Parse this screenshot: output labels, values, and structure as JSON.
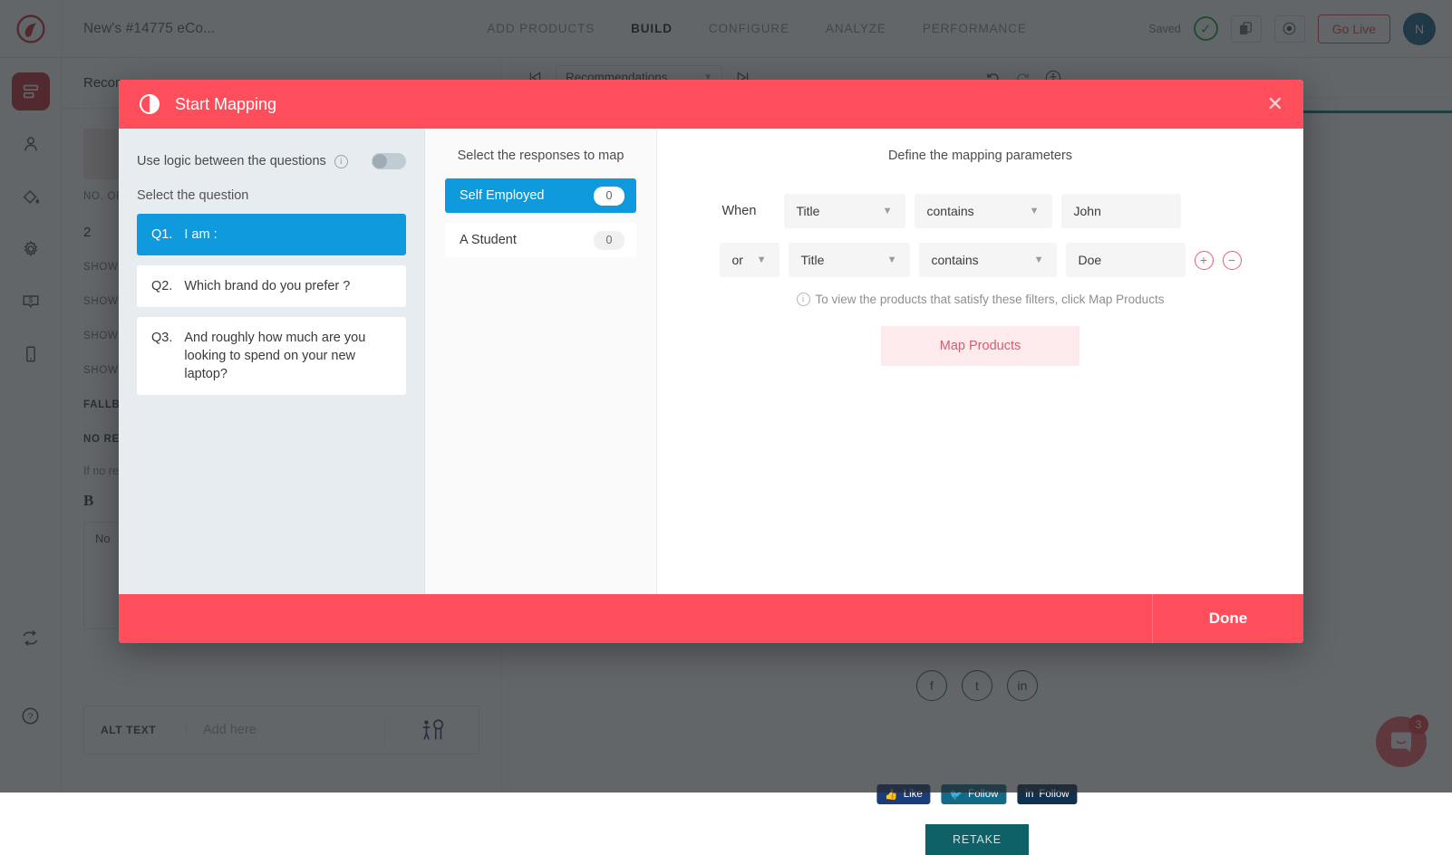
{
  "topbar": {
    "logo_icon": "brand-logo-icon",
    "project_title": "New's #14775 eCo...",
    "nav": [
      {
        "label": "ADD PRODUCTS",
        "active": false
      },
      {
        "label": "BUILD",
        "active": true
      },
      {
        "label": "CONFIGURE",
        "active": false
      },
      {
        "label": "ANALYZE",
        "active": false
      },
      {
        "label": "PERFORMANCE",
        "active": false
      }
    ],
    "saved_label": "Saved",
    "saved_check_icon": "check-circle-icon",
    "copy_icon": "duplicate-icon",
    "preview_icon": "eye-icon",
    "go_live_label": "Go Live",
    "avatar_initial": "N"
  },
  "rail": {
    "items": [
      {
        "icon": "content-list-icon",
        "active": true
      },
      {
        "icon": "person-icon",
        "active": false
      },
      {
        "icon": "paint-bucket-icon",
        "active": false
      },
      {
        "icon": "gear-icon",
        "active": false
      },
      {
        "icon": "price-bubble-icon",
        "active": false
      },
      {
        "icon": "mobile-device-icon",
        "active": false
      }
    ],
    "bottom": [
      {
        "icon": "sync-icon"
      },
      {
        "icon": "help-circle-icon"
      }
    ]
  },
  "config_panel": {
    "heading": "Recom",
    "no_of_label": "NO. OF",
    "no_of_value": "2",
    "show_rows": [
      "SHOW",
      "SHOW",
      "SHOW",
      "SHOW"
    ],
    "fallback_label": "FALLBA",
    "no_results_label": "NO RE",
    "if_no_text": "If no re",
    "bold_tool": "B",
    "editor_text": "No",
    "alt_text_label": "ALT TEXT",
    "alt_text_placeholder": "Add here",
    "alt_image_icon": "person-search-icon"
  },
  "preview_toolbar": {
    "prev_icon": "skip-previous-icon",
    "select_value": "Recommendations",
    "caret_icon": "chevron-down-icon",
    "next_icon": "skip-next-icon",
    "undo_icon": "undo-icon",
    "redo_icon": "redo-icon",
    "accessibility_icon": "accessibility-icon"
  },
  "preview": {
    "social_circles": [
      {
        "icon": "facebook-icon",
        "glyph": "f"
      },
      {
        "icon": "twitter-icon",
        "glyph": "t"
      },
      {
        "icon": "linkedin-icon",
        "glyph": "in"
      }
    ],
    "social_buttons": [
      {
        "icon": "thumbs-up-icon",
        "label": "Like"
      },
      {
        "icon": "twitter-bird-icon",
        "label": "Follow"
      },
      {
        "icon": "linkedin-in-icon",
        "label": "Follow"
      }
    ],
    "retake_label": "RETAKE"
  },
  "intercom": {
    "icon": "chat-bubble-icon",
    "badge": "3"
  },
  "modal": {
    "icon": "contrast-circle-icon",
    "title": "Start Mapping",
    "close_icon": "close-icon",
    "left": {
      "logic_label": "Use logic between the questions",
      "logic_info_icon": "info-icon",
      "logic_toggle_on": false,
      "select_question_label": "Select the question",
      "questions": [
        {
          "num": "Q1.",
          "text": "I am :",
          "active": true
        },
        {
          "num": "Q2.",
          "text": "Which brand do you prefer ?",
          "active": false
        },
        {
          "num": "Q3.",
          "text": "And roughly how much are you looking to spend on your new laptop?",
          "active": false
        }
      ]
    },
    "mid": {
      "title": "Select the responses to map",
      "responses": [
        {
          "label": "Self Employed",
          "count": "0",
          "active": true
        },
        {
          "label": "A Student",
          "count": "0",
          "active": false
        }
      ]
    },
    "right": {
      "title": "Define the mapping parameters",
      "rows": [
        {
          "prefix_label": "When",
          "prefix_is_select": false,
          "field": "Title",
          "condition": "contains",
          "value": "John",
          "show_buttons": false
        },
        {
          "prefix_label": "or",
          "prefix_is_select": true,
          "field": "Title",
          "condition": "contains",
          "value": "Doe",
          "show_buttons": true
        }
      ],
      "add_icon": "plus-circle-icon",
      "remove_icon": "minus-circle-icon",
      "hint_icon": "info-icon",
      "hint": "To view the products that satisfy these filters, click Map Products",
      "map_products_label": "Map Products"
    },
    "footer": {
      "done_label": "Done"
    }
  },
  "colors": {
    "modal_header": "#ff4e5b",
    "accent_blue": "#0e9adc",
    "brand_red": "#c0262e",
    "go_live_red": "#d8454f",
    "pane_left_bg": "#e6ecef",
    "map_products_bg": "#fdeaed",
    "map_products_fg": "#d15f70",
    "teal": "#0d6c74"
  }
}
